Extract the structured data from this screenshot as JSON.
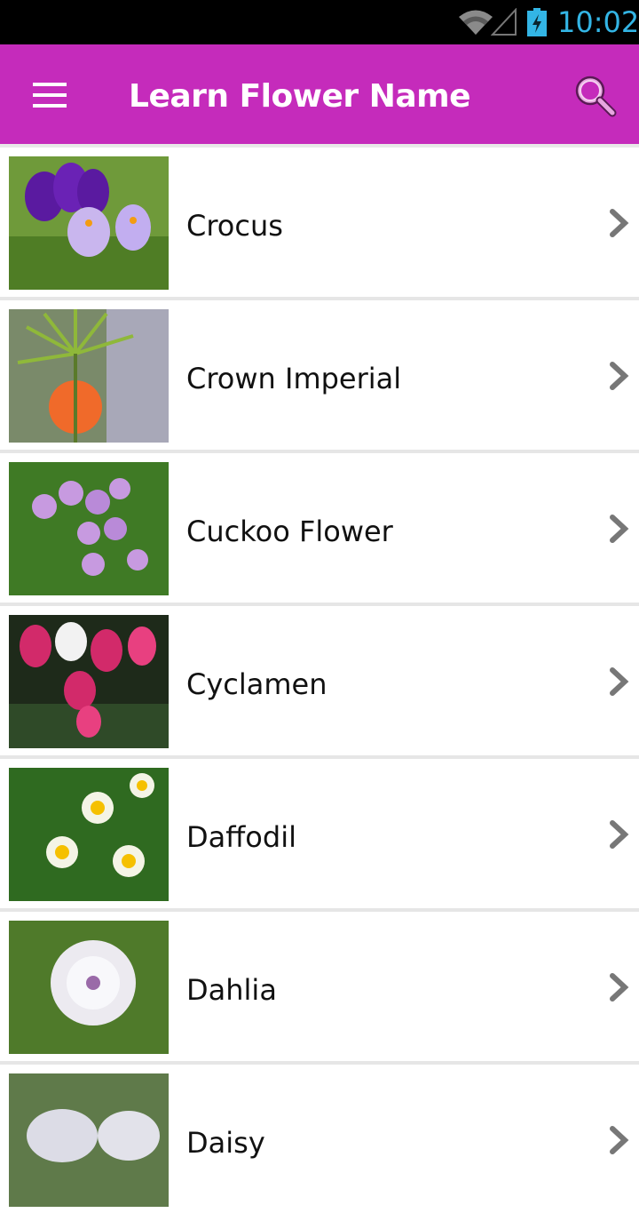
{
  "status_bar": {
    "time": "10:02",
    "icons": [
      "wifi-icon",
      "cell-signal-icon",
      "battery-charging-icon"
    ],
    "time_color": "#33b5e5"
  },
  "app_bar": {
    "title": "Learn Flower Name",
    "background_color": "#c52bbb",
    "left_icon": "menu-icon",
    "right_icon": "search-icon"
  },
  "flowers": [
    {
      "name": "Crocus",
      "image": "crocus-photo"
    },
    {
      "name": "Crown Imperial",
      "image": "crown-imperial-photo"
    },
    {
      "name": "Cuckoo Flower",
      "image": "cuckoo-flower-photo"
    },
    {
      "name": "Cyclamen",
      "image": "cyclamen-photo"
    },
    {
      "name": "Daffodil",
      "image": "daffodil-photo"
    },
    {
      "name": "Dahlia",
      "image": "dahlia-photo"
    },
    {
      "name": "Daisy",
      "image": "daisy-photo"
    }
  ]
}
